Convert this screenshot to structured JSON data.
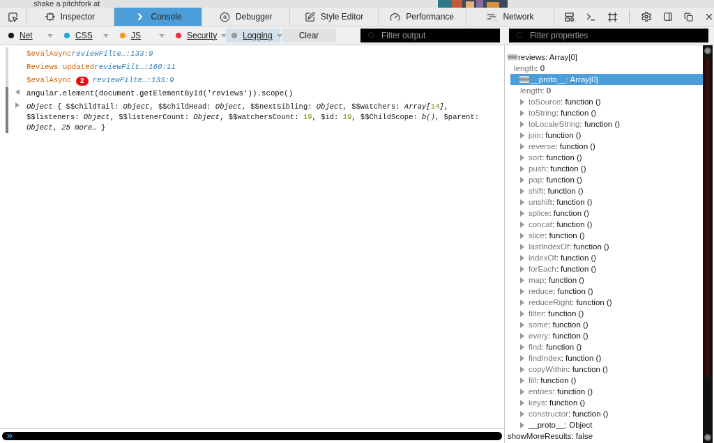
{
  "page_behind": {
    "text": "shake a pitchfork at"
  },
  "toolbox": {
    "tabs": [
      {
        "label": "Inspector",
        "selected": false
      },
      {
        "label": "Console",
        "selected": true
      },
      {
        "label": "Debugger",
        "selected": false
      },
      {
        "label": "Style Editor",
        "selected": false
      },
      {
        "label": "Performance",
        "selected": false
      },
      {
        "label": "Network",
        "selected": false
      }
    ]
  },
  "filters": [
    {
      "label": "Net",
      "color": "#1a1a1a",
      "selected": false
    },
    {
      "label": "CSS",
      "color": "#1ea7e4",
      "selected": false
    },
    {
      "label": "JS",
      "color": "#f5951f",
      "selected": false
    },
    {
      "label": "Security",
      "color": "#e8313a",
      "selected": false
    },
    {
      "label": "Logging",
      "color": "#9a9a9a",
      "selected": true
    }
  ],
  "clear_button": "Clear",
  "filter_output": {
    "placeholder": "Filter output"
  },
  "messages": [
    {
      "kind": "log",
      "text": "$evalAsync",
      "location": "reviewFilte…:133:9"
    },
    {
      "kind": "log",
      "text": "Reviews updated",
      "location": "reviewFilt…:160:11"
    },
    {
      "kind": "log",
      "text": "$evalAsync",
      "count": "2",
      "location": "reviewFilte…:133:9"
    },
    {
      "kind": "input",
      "text": "angular.element(document.getElementById('reviews')).scope()"
    },
    {
      "kind": "output",
      "segments": [
        {
          "text": "Object",
          "kind": "italic"
        },
        {
          "text": " { $$childTail: ",
          "kind": "plain"
        },
        {
          "text": "Object",
          "kind": "italic"
        },
        {
          "text": ", $$childHead: ",
          "kind": "plain"
        },
        {
          "text": "Object",
          "kind": "italic"
        },
        {
          "text": ", $$nextSibling: ",
          "kind": "plain"
        },
        {
          "text": "Object",
          "kind": "italic"
        },
        {
          "text": ", $$watchers: ",
          "kind": "plain"
        },
        {
          "text": "Array[",
          "kind": "italic"
        },
        {
          "text": "14",
          "kind": "number"
        },
        {
          "text": "]",
          "kind": "italic"
        },
        {
          "text": ", $$listeners: ",
          "kind": "plain"
        },
        {
          "text": "Object",
          "kind": "italic"
        },
        {
          "text": ", $$listenerCount: ",
          "kind": "plain"
        },
        {
          "text": "Object",
          "kind": "italic"
        },
        {
          "text": ", $$watchersCount: ",
          "kind": "plain"
        },
        {
          "text": "19",
          "kind": "number"
        },
        {
          "text": ", $id: ",
          "kind": "plain"
        },
        {
          "text": "19",
          "kind": "number"
        },
        {
          "text": ", $$ChildScope: ",
          "kind": "plain"
        },
        {
          "text": "b()",
          "kind": "italic"
        },
        {
          "text": ", $parent: ",
          "kind": "plain"
        },
        {
          "text": "Object",
          "kind": "italic"
        },
        {
          "text": ", ",
          "kind": "plain"
        },
        {
          "text": "25 more…",
          "kind": "italic"
        },
        {
          "text": " }",
          "kind": "plain"
        }
      ]
    }
  ],
  "variables": {
    "filter": {
      "placeholder": "Filter properties"
    },
    "tree": [
      {
        "name": "reviews",
        "value": ": Array[0]",
        "enumerable": true,
        "expanded": true,
        "selected": false,
        "children": [
          {
            "name": "length",
            "value": ": 0",
            "enumerable": false,
            "selected": false
          },
          {
            "name": "__proto__",
            "value": ": Array[0]",
            "enumerable": false,
            "expanded": true,
            "selected": true,
            "children": [
              {
                "name": "length",
                "value": ": 0",
                "enumerable": false,
                "selected": false
              },
              {
                "name": "toSource",
                "value": ": function ()",
                "enumerable": false,
                "expanded": false,
                "selected": false
              },
              {
                "name": "toString",
                "value": ": function ()",
                "enumerable": false,
                "expanded": false,
                "selected": false
              },
              {
                "name": "toLocaleString",
                "value": ": function ()",
                "enumerable": false,
                "expanded": false,
                "selected": false
              },
              {
                "name": "join",
                "value": ": function ()",
                "enumerable": false,
                "expanded": false,
                "selected": false
              },
              {
                "name": "reverse",
                "value": ": function ()",
                "enumerable": false,
                "expanded": false,
                "selected": false
              },
              {
                "name": "sort",
                "value": ": function ()",
                "enumerable": false,
                "expanded": false,
                "selected": false
              },
              {
                "name": "push",
                "value": ": function ()",
                "enumerable": false,
                "expanded": false,
                "selected": false
              },
              {
                "name": "pop",
                "value": ": function ()",
                "enumerable": false,
                "expanded": false,
                "selected": false
              },
              {
                "name": "shift",
                "value": ": function ()",
                "enumerable": false,
                "expanded": false,
                "selected": false
              },
              {
                "name": "unshift",
                "value": ": function ()",
                "enumerable": false,
                "expanded": false,
                "selected": false
              },
              {
                "name": "splice",
                "value": ": function ()",
                "enumerable": false,
                "expanded": false,
                "selected": false
              },
              {
                "name": "concat",
                "value": ": function ()",
                "enumerable": false,
                "expanded": false,
                "selected": false
              },
              {
                "name": "slice",
                "value": ": function ()",
                "enumerable": false,
                "expanded": false,
                "selected": false
              },
              {
                "name": "lastIndexOf",
                "value": ": function ()",
                "enumerable": false,
                "expanded": false,
                "selected": false
              },
              {
                "name": "indexOf",
                "value": ": function ()",
                "enumerable": false,
                "expanded": false,
                "selected": false
              },
              {
                "name": "forEach",
                "value": ": function ()",
                "enumerable": false,
                "expanded": false,
                "selected": false
              },
              {
                "name": "map",
                "value": ": function ()",
                "enumerable": false,
                "expanded": false,
                "selected": false
              },
              {
                "name": "reduce",
                "value": ": function ()",
                "enumerable": false,
                "expanded": false,
                "selected": false
              },
              {
                "name": "reduceRight",
                "value": ": function ()",
                "enumerable": false,
                "expanded": false,
                "selected": false
              },
              {
                "name": "filter",
                "value": ": function ()",
                "enumerable": false,
                "expanded": false,
                "selected": false
              },
              {
                "name": "some",
                "value": ": function ()",
                "enumerable": false,
                "expanded": false,
                "selected": false
              },
              {
                "name": "every",
                "value": ": function ()",
                "enumerable": false,
                "expanded": false,
                "selected": false
              },
              {
                "name": "find",
                "value": ": function ()",
                "enumerable": false,
                "expanded": false,
                "selected": false
              },
              {
                "name": "findIndex",
                "value": ": function ()",
                "enumerable": false,
                "expanded": false,
                "selected": false
              },
              {
                "name": "copyWithin",
                "value": ": function ()",
                "enumerable": false,
                "expanded": false,
                "selected": false
              },
              {
                "name": "fill",
                "value": ": function ()",
                "enumerable": false,
                "expanded": false,
                "selected": false
              },
              {
                "name": "entries",
                "value": ": function ()",
                "enumerable": false,
                "expanded": false,
                "selected": false
              },
              {
                "name": "keys",
                "value": ": function ()",
                "enumerable": false,
                "expanded": false,
                "selected": false
              },
              {
                "name": "constructor",
                "value": ": function ()",
                "enumerable": false,
                "expanded": false,
                "selected": false
              },
              {
                "name": "__proto__",
                "value": ": Object",
                "enumerable": true,
                "expanded": false,
                "selected": false
              }
            ]
          }
        ]
      },
      {
        "name": "showMoreResults",
        "value": ": false",
        "enumerable": true,
        "selected": false
      }
    ]
  }
}
